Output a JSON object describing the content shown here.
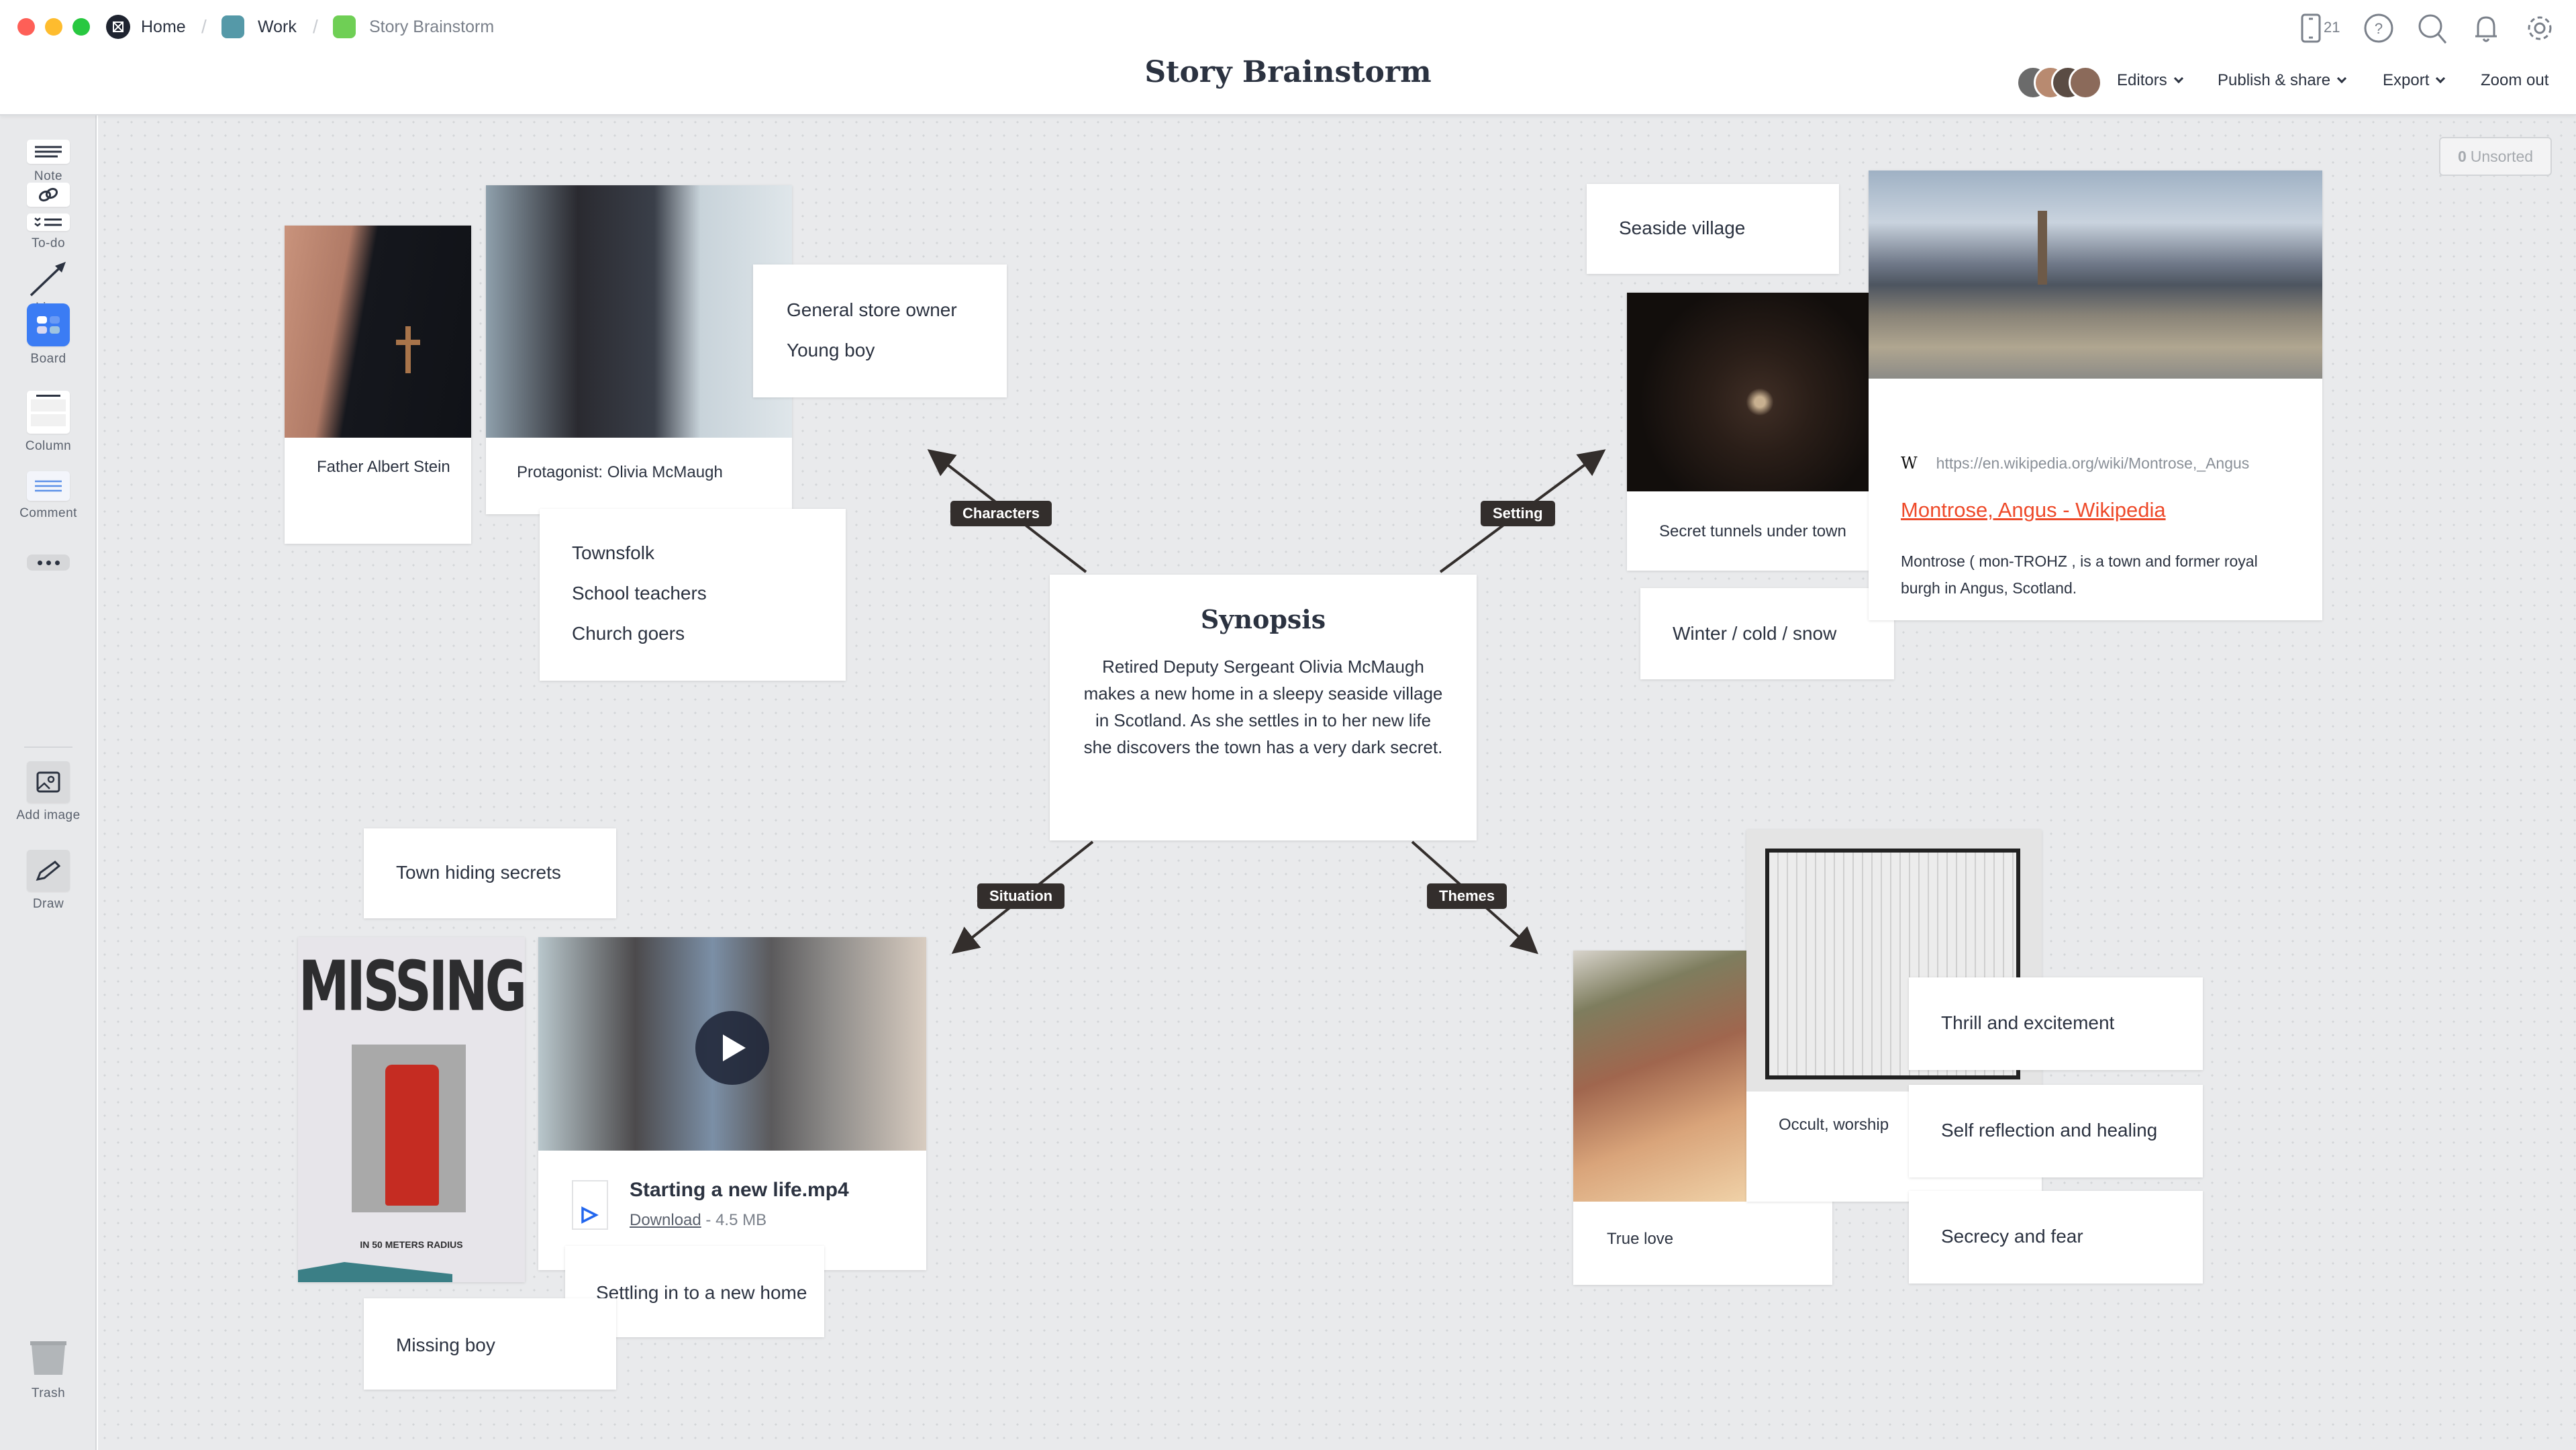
{
  "window": {
    "breadcrumbs": [
      {
        "label": "Home",
        "color": "#1f2430"
      },
      {
        "label": "Work",
        "color": "#5599a8"
      },
      {
        "label": "Story Brainstorm",
        "color": "#6fcf55"
      }
    ],
    "title": "Story Brainstorm",
    "device_count": "21",
    "menus": {
      "editors": "Editors",
      "publish": "Publish & share",
      "export": "Export",
      "zoom_out": "Zoom out"
    }
  },
  "sidebar": {
    "tools": [
      {
        "label": "Note",
        "icon": "note-icon"
      },
      {
        "label": "Link",
        "icon": "link-icon"
      },
      {
        "label": "To-do",
        "icon": "todo-icon"
      },
      {
        "label": "Line",
        "icon": "line-arrow-icon"
      },
      {
        "label": "Board",
        "icon": "board-icon"
      },
      {
        "label": "Column",
        "icon": "column-icon"
      },
      {
        "label": "Comment",
        "icon": "comment-icon"
      },
      {
        "label": "",
        "icon": "more-icon"
      },
      {
        "label": "Add image",
        "icon": "image-icon"
      },
      {
        "label": "Draw",
        "icon": "pencil-icon"
      },
      {
        "label": "Trash",
        "icon": "trash-icon"
      }
    ]
  },
  "canvas": {
    "unsorted": {
      "count": "0",
      "label": "Unsorted"
    },
    "synopsis": {
      "title": "Synopsis",
      "body": "Retired Deputy Sergeant Olivia McMaugh makes a new home in a sleepy seaside village in Scotland. As she settles in to her new life she discovers the town has a very dark secret."
    },
    "connectors": [
      "Characters",
      "Setting",
      "Situation",
      "Themes"
    ],
    "characters": {
      "father": "Father Albert Stein",
      "protagonist": "Protagonist: Olivia McMaugh",
      "list1": [
        "General store owner",
        "Young boy"
      ],
      "list2": [
        "Townsfolk",
        "School teachers",
        "Church goers"
      ]
    },
    "setting": {
      "seaside": "Seaside village",
      "tunnels": "Secret tunnels under town",
      "winter": "Winter / cold / snow",
      "link": {
        "url": "https://en.wikipedia.org/wiki/Montrose,_Angus",
        "title": "Montrose, Angus - Wikipedia",
        "description": "Montrose ( mon-TROHZ , is a town and former royal burgh in Angus, Scotland.",
        "favicon": "W"
      }
    },
    "situation": {
      "town_secrets": "Town hiding secrets",
      "missing_boy": "Missing boy",
      "settling": "Settling in to a new home",
      "poster": {
        "headline": "MISSING",
        "subtitle": "IN 50 METERS RADIUS"
      },
      "video": {
        "filename": "Starting a new life.mp4",
        "download": "Download",
        "size": "- 4.5 MB"
      }
    },
    "themes": {
      "thrill": "Thrill and excitement",
      "reflection": "Self reflection and healing",
      "secrecy": "Secrecy and fear",
      "occult": "Occult, worship",
      "love": "True love"
    }
  },
  "colors": {
    "accent_blue": "#3b7cf4",
    "link_red": "#ee4a2a",
    "chip_dark": "#332e2c"
  }
}
